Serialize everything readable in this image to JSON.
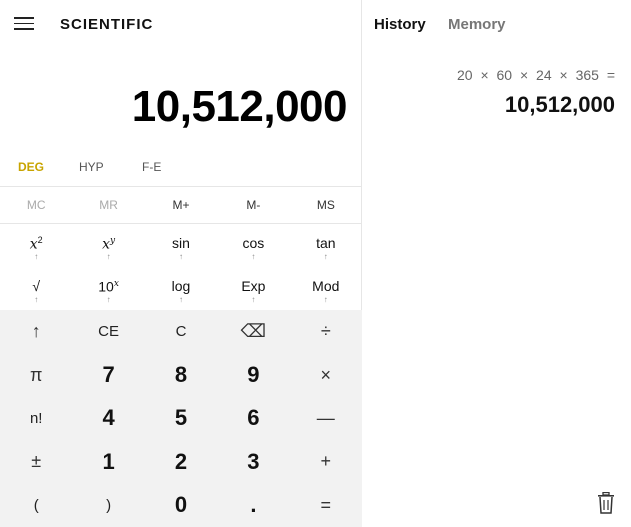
{
  "calculator": {
    "mode_title": "SCIENTIFIC",
    "display_value": "10,512,000",
    "angle_modes": {
      "deg": "DEG",
      "hyp": "HYP",
      "fe": "F-E"
    },
    "memory": {
      "mc": "MC",
      "mr": "MR",
      "mplus": "M+",
      "mminus": "M-",
      "ms": "MS"
    },
    "sci_row1": {
      "tan": "tan",
      "sin": "sin",
      "cos": "cos"
    },
    "sci_row2": {
      "sqrt": "√",
      "log": "log",
      "exp": "Exp",
      "mod": "Mod"
    },
    "arrow_glyph": "↑",
    "pad": {
      "up": "↑",
      "ce": "CE",
      "c": "C",
      "back": "⌫",
      "div": "÷",
      "pi": "π",
      "n7": "7",
      "n8": "8",
      "n9": "9",
      "mul": "×",
      "fact": "n!",
      "n4": "4",
      "n5": "5",
      "n6": "6",
      "sub": "—",
      "pm": "±",
      "n1": "1",
      "n2": "2",
      "n3": "3",
      "add": "+",
      "lparen": "(",
      "rparen": ")",
      "n0": "0",
      "dot": ".",
      "eq": "="
    }
  },
  "history_panel": {
    "tab_history": "History",
    "tab_memory": "Memory",
    "entries": [
      {
        "expression": "20 × 60 × 24 × 365 =",
        "result": "10,512,000"
      }
    ]
  },
  "colors": {
    "accent_deg": "#c8a400",
    "pad_bg": "#f2f2f2"
  }
}
